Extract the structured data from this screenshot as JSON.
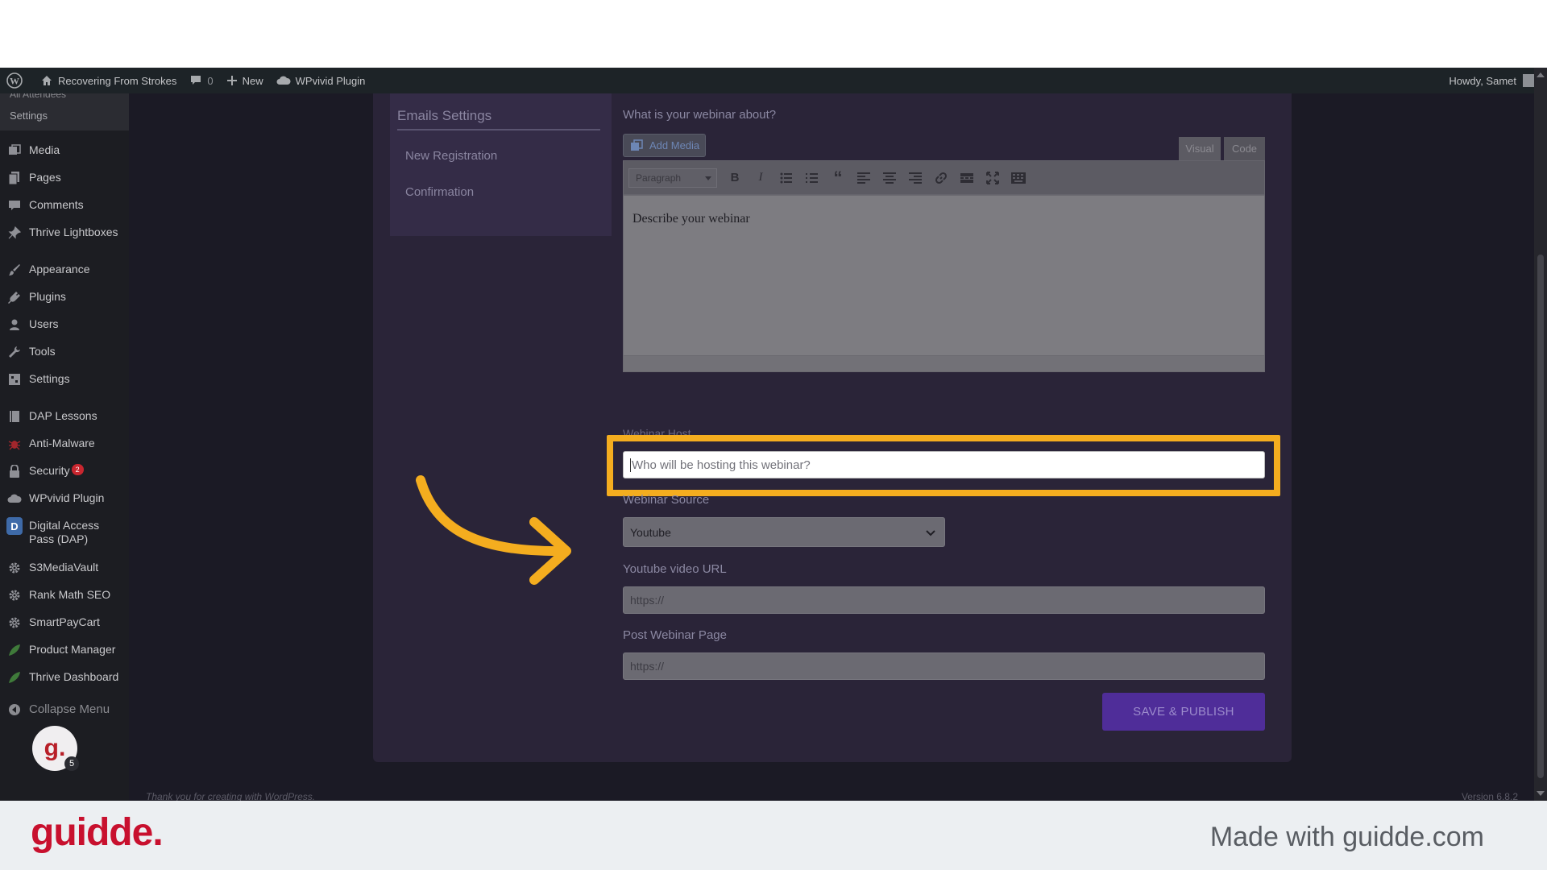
{
  "admin_bar": {
    "site_name": "Recovering From Strokes",
    "comments_count": "0",
    "new_label": "New",
    "plugin_label": "WPvivid Plugin",
    "greeting": "Howdy, Samet"
  },
  "sidebar": {
    "submenu_cut_label": "All Attendees",
    "submenu_settings": "Settings",
    "items": [
      {
        "label": "Media",
        "icon": "media-icon"
      },
      {
        "label": "Pages",
        "icon": "pages-icon"
      },
      {
        "label": "Comments",
        "icon": "comments-icon"
      },
      {
        "label": "Thrive Lightboxes",
        "icon": "pin-icon"
      },
      {
        "label": "Appearance",
        "icon": "paintbrush-icon"
      },
      {
        "label": "Plugins",
        "icon": "plugin-icon"
      },
      {
        "label": "Users",
        "icon": "users-icon"
      },
      {
        "label": "Tools",
        "icon": "wrench-icon"
      },
      {
        "label": "Settings",
        "icon": "settings-icon"
      },
      {
        "label": "DAP Lessons",
        "icon": "book-icon"
      },
      {
        "label": "Anti-Malware",
        "icon": "bug-icon"
      },
      {
        "label": "Security",
        "icon": "lock-icon",
        "badge": "2"
      },
      {
        "label": "WPvivid Plugin",
        "icon": "cloud-icon"
      },
      {
        "label": "Digital Access Pass (DAP)",
        "icon": "dap-icon"
      },
      {
        "label": "S3MediaVault",
        "icon": "gear-icon"
      },
      {
        "label": "Rank Math SEO",
        "icon": "gear-icon"
      },
      {
        "label": "SmartPayCart",
        "icon": "gear-icon"
      },
      {
        "label": "Product Manager",
        "icon": "leaf-icon"
      },
      {
        "label": "Thrive Dashboard",
        "icon": "leaf-icon"
      }
    ],
    "collapse_label": "Collapse Menu",
    "avatar_letter": "g.",
    "avatar_badge": "5"
  },
  "emails_settings": {
    "title": "Emails Settings",
    "links": [
      "New Registration",
      "Confirmation"
    ]
  },
  "form": {
    "about_label": "What is your webinar about?",
    "add_media_label": "Add Media",
    "tab_visual": "Visual",
    "tab_code": "Code",
    "format_select": "Paragraph",
    "editor_placeholder": "Describe your webinar",
    "host_label": "Webinar Host",
    "host_placeholder": "Who will be hosting this webinar?",
    "source_label": "Webinar Source",
    "source_value": "Youtube",
    "video_url_label": "Youtube video URL",
    "video_url_placeholder": "https://",
    "post_page_label": "Post Webinar Page",
    "post_page_placeholder": "https://",
    "save_label": "SAVE & PUBLISH"
  },
  "footer": {
    "thanks": "Thank you for creating with WordPress.",
    "version": "Version 6.8.2"
  },
  "branding": {
    "logo": "guidde.",
    "made_with": "Made with guidde.com"
  },
  "colors": {
    "highlight": "#f4ad1f",
    "save_button": "#4f2d99",
    "guidde_red": "#c8102e"
  }
}
